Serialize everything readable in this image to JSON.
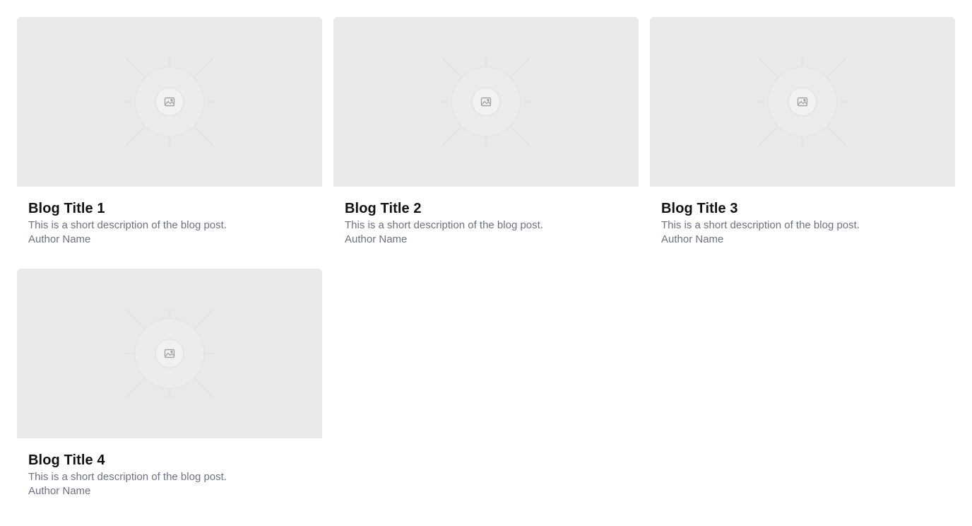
{
  "posts": [
    {
      "title": "Blog Title 1",
      "description": "This is a short description of the blog post.",
      "author": "Author Name",
      "image_icon": "image-placeholder-icon"
    },
    {
      "title": "Blog Title 2",
      "description": "This is a short description of the blog post.",
      "author": "Author Name",
      "image_icon": "image-placeholder-icon"
    },
    {
      "title": "Blog Title 3",
      "description": "This is a short description of the blog post.",
      "author": "Author Name",
      "image_icon": "image-placeholder-icon"
    },
    {
      "title": "Blog Title 4",
      "description": "This is a short description of the blog post.",
      "author": "Author Name",
      "image_icon": "image-placeholder-icon"
    }
  ],
  "colors": {
    "image_background": "#e9e9e9",
    "title": "#111111",
    "meta_text": "#6b7280",
    "page_background": "#ffffff"
  }
}
